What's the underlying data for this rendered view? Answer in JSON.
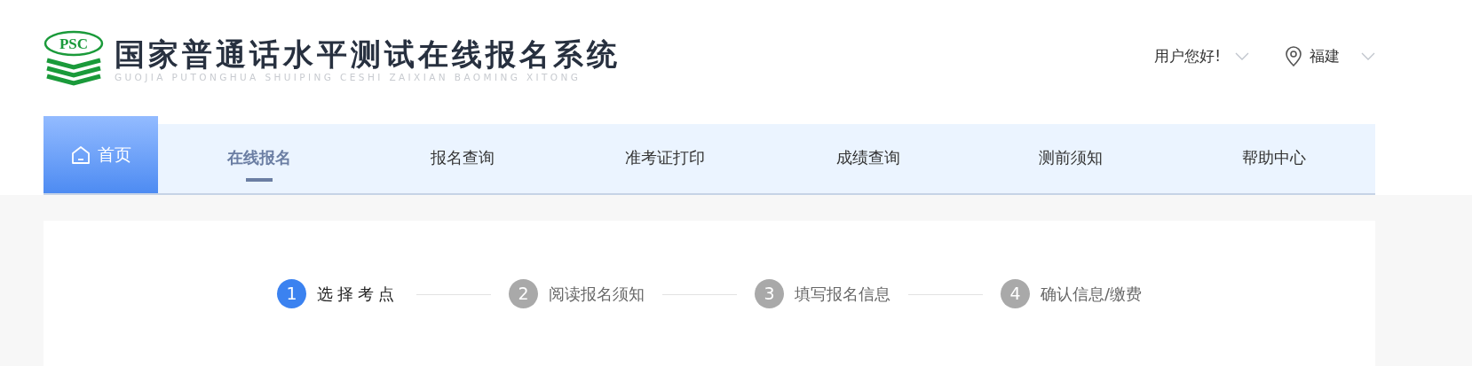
{
  "header": {
    "logo_mark": "PSC",
    "title": "国家普通话水平测试在线报名系统",
    "subtitle": "GUOJIA PUTONGHUA SHUIPING CESHI ZAIXIAN BAOMING XITONG",
    "user_menu": "用户您好!",
    "region": "福建"
  },
  "nav": [
    {
      "kind": "home",
      "label": "首页",
      "selected": false
    },
    {
      "kind": "link",
      "label": "在线报名",
      "selected": true
    },
    {
      "kind": "link",
      "label": "报名查询",
      "selected": false
    },
    {
      "kind": "link",
      "label": "准考证打印",
      "selected": false
    },
    {
      "kind": "link",
      "label": "成绩查询",
      "selected": false
    },
    {
      "kind": "link",
      "label": "测前须知",
      "selected": false
    },
    {
      "kind": "link",
      "label": "帮助中心",
      "selected": false
    }
  ],
  "steps": [
    {
      "number": "1",
      "label": "选择考点",
      "active": true
    },
    {
      "number": "2",
      "label": "阅读报名须知",
      "active": false
    },
    {
      "number": "3",
      "label": "填写报名信息",
      "active": false
    },
    {
      "number": "4",
      "label": "确认信息/缴费",
      "active": false
    }
  ]
}
